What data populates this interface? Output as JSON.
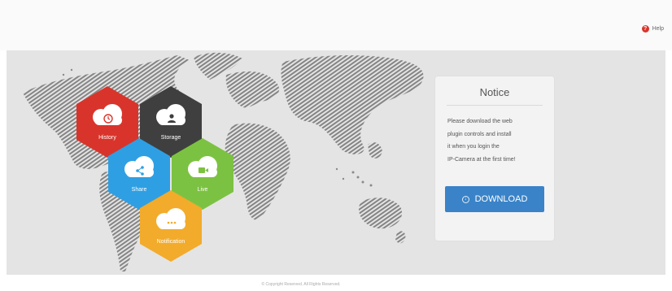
{
  "header": {
    "help_label": "Help",
    "help_icon": "question-circle-icon"
  },
  "features": [
    {
      "label": "History",
      "color": "#d9342b",
      "icon": "clock-cloud-icon"
    },
    {
      "label": "Storage",
      "color": "#3f3f3f",
      "icon": "person-cloud-icon"
    },
    {
      "label": "Share",
      "color": "#2f9fe3",
      "icon": "share-cloud-icon"
    },
    {
      "label": "Live",
      "color": "#7cc242",
      "icon": "camera-cloud-icon"
    },
    {
      "label": "Notification",
      "color": "#f2ab2b",
      "icon": "chat-cloud-icon"
    }
  ],
  "notice": {
    "title": "Notice",
    "lines": [
      "Please download the web",
      "plugin controls and install",
      "it when you login the",
      "IP-Camera at the first time!"
    ],
    "download_label": "DOWNLOAD",
    "download_icon": "download-arrow-icon",
    "button_color": "#3a83c8"
  },
  "footer": {
    "copyright": "© Copyright Reserved. All Rights Reserved."
  }
}
